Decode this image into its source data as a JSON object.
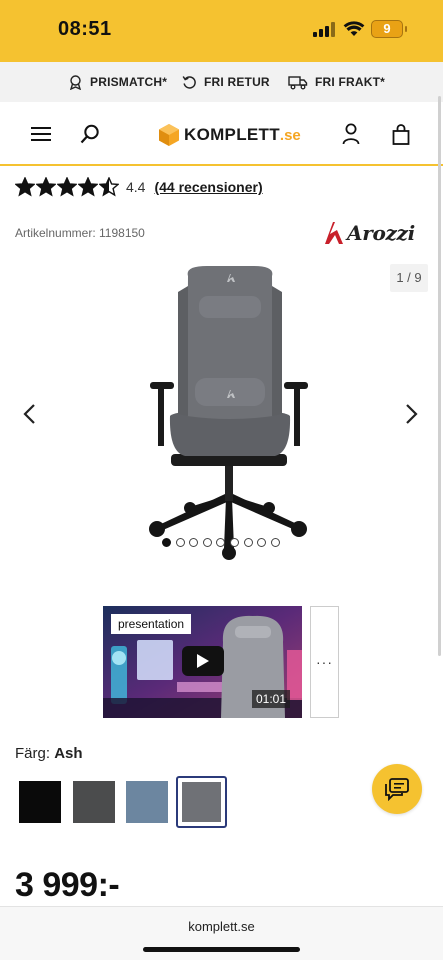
{
  "status_bar": {
    "time": "08:51",
    "battery": "9"
  },
  "usp_bar": {
    "items": [
      {
        "label": "PRISMATCH*",
        "icon": "medal-icon"
      },
      {
        "label": "FRI RETUR",
        "icon": "return-icon"
      },
      {
        "label": "FRI FRAKT*",
        "icon": "truck-icon"
      }
    ]
  },
  "header": {
    "logo_text": "KOMPLETT",
    "logo_suffix": ".se",
    "icons": [
      "menu-icon",
      "search-icon",
      "account-icon",
      "cart-icon"
    ]
  },
  "product": {
    "rating_value": "4.4",
    "rating_stars": 4.5,
    "reviews_link": "(44 recensioner)",
    "article_number": "Artikelnummer: 1198150",
    "brand": "Arozzi",
    "gallery_counter": "1 / 9",
    "gallery_dots": 9,
    "gallery_active_dot": 1,
    "video_label": "presentation",
    "video_duration": "01:01",
    "more_thumbs": "···",
    "color_label": "Färg:",
    "color_value": "Ash",
    "swatches": [
      {
        "name": "black",
        "color": "#0a0a0a"
      },
      {
        "name": "dark-grey",
        "color": "#4b4c4d"
      },
      {
        "name": "blue-grey",
        "color": "#6c86a0"
      },
      {
        "name": "ash",
        "color": "#6f7176",
        "selected": true
      }
    ],
    "price": "3 999:-"
  },
  "browser": {
    "url": "komplett.se"
  },
  "colors": {
    "accent": "#f5c230",
    "selected_border": "#2b3a7a"
  }
}
